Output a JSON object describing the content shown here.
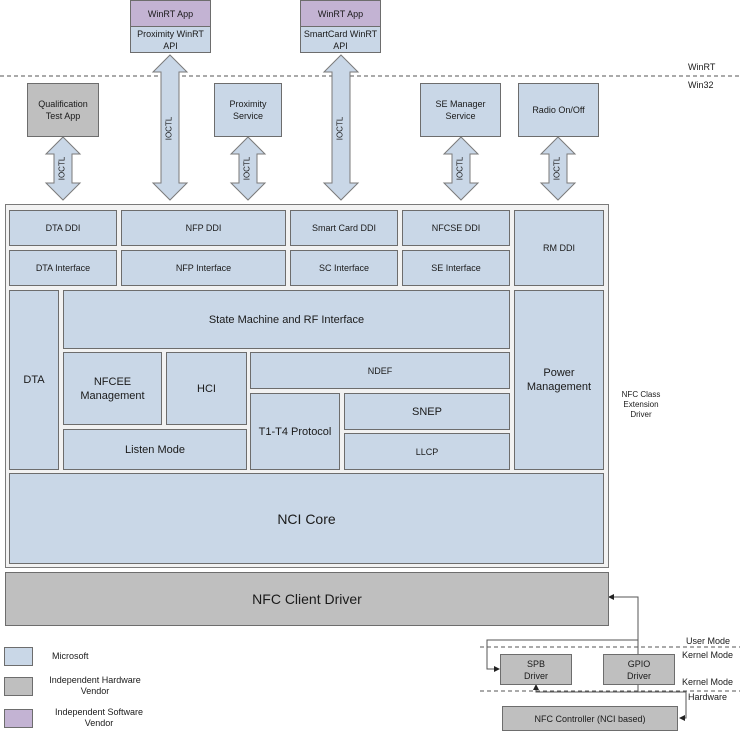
{
  "boundaries": {
    "winrt": "WinRT",
    "win32": "Win32",
    "user_mode": "User Mode",
    "kernel_mode_top": "Kernel Mode",
    "kernel_mode_bottom": "Kernel Mode",
    "hardware": "Hardware"
  },
  "apps": {
    "winrt_app_1": "WinRT App",
    "proximity_winrt_api": "Proximity WinRT API",
    "winrt_app_2": "WinRT App",
    "smartcard_winrt_api": "SmartCard WinRT API",
    "qualification_test_app": "Qualification Test App",
    "proximity_service": "Proximity Service",
    "se_manager_service": "SE Manager Service",
    "radio_onoff": "Radio On/Off"
  },
  "arrow_label": "IOCTL",
  "ddi_row": [
    "DTA DDI",
    "NFP DDI",
    "Smart Card DDI",
    "NFCSE DDI",
    "RM DDI"
  ],
  "interface_row": [
    "DTA Interface",
    "NFP Interface",
    "SC Interface",
    "SE Interface"
  ],
  "core": {
    "dta": "DTA",
    "state_machine": "State Machine and RF Interface",
    "power_management": "Power Management",
    "nfcee_management": "NFCEE Management",
    "hci": "HCI",
    "ndef": "NDEF",
    "t1t4": "T1-T4 Protocol",
    "snep": "SNEP",
    "llcp": "LLCP",
    "listen_mode": "Listen Mode",
    "nci_core": "NCI Core",
    "class_extension_label": "NFC Class Extension Driver"
  },
  "drivers": {
    "nfc_client_driver": "NFC Client Driver",
    "spb_driver": "SPB Driver",
    "gpio_driver": "GPIO Driver",
    "nfc_controller": "NFC Controller (NCI based)"
  },
  "legend": [
    {
      "label": "Microsoft",
      "color": "#c9d7e7"
    },
    {
      "label": "Independent Hardware Vendor",
      "color": "#bfbfbf"
    },
    {
      "label": "Independent Software Vendor",
      "color": "#c3b3d3"
    }
  ]
}
